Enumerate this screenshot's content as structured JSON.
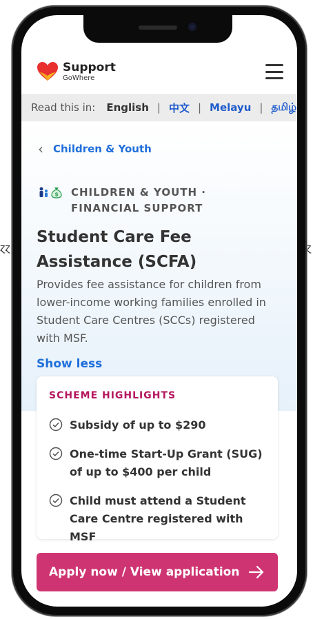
{
  "side_marks": {
    "left": "ɀɀ",
    "right": "ɀ"
  },
  "header": {
    "logo_line1": "Support",
    "logo_line2": "GoWhere"
  },
  "language_bar": {
    "label": "Read this in:",
    "options": [
      "English",
      "中文",
      "Melayu",
      "தமிழ்"
    ],
    "selected": "English"
  },
  "breadcrumb": {
    "label": "Children & Youth"
  },
  "scheme": {
    "category_line1": "CHILDREN & YOUTH ·",
    "category_line2": "FINANCIAL SUPPORT",
    "title": "Student Care Fee Assistance (SCFA)",
    "description": "Provides fee assistance for children from lower-income working families enrolled in Student Care Centres (SCCs) registered with MSF.",
    "toggle_label": "Show less"
  },
  "highlights": {
    "heading": "SCHEME HIGHLIGHTS",
    "items": [
      "Subsidy of up to $290",
      "One-time Start-Up Grant (SUG) of up to $400 per child",
      "Child must attend a Student Care Centre registered with MSF"
    ]
  },
  "cta": {
    "label": "Apply now / View application"
  },
  "colors": {
    "accent_blue": "#1f6fdb",
    "highlight_pink": "#b5175f",
    "cta_pink": "#cf3472",
    "lang_bar_bg": "#ececec"
  }
}
